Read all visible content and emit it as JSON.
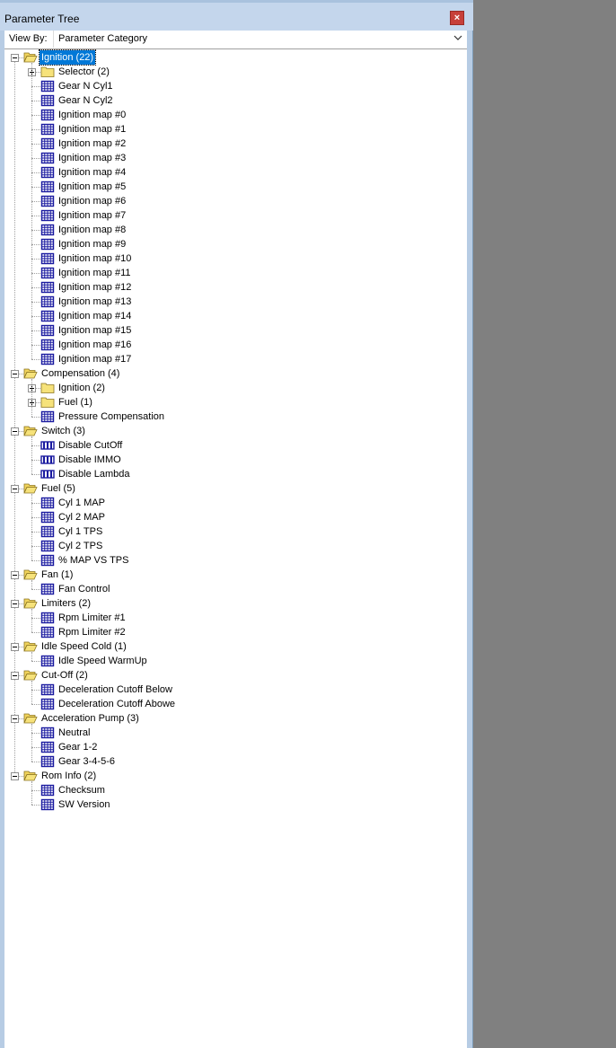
{
  "window": {
    "title": "Parameter Tree",
    "close_glyph": "×"
  },
  "view_by": {
    "label": "View By:",
    "value": "Parameter Category"
  },
  "colors": {
    "selection": "#0078d7",
    "folder": "#f6e27a",
    "table_icon": "#1a1aa0",
    "background": "#808080"
  },
  "tree": [
    {
      "label": "Ignition (22)",
      "type": "folder-open",
      "expanded": true,
      "selected": true,
      "children": [
        {
          "label": "Selector (2)",
          "type": "folder",
          "expanded": false
        },
        {
          "label": "Gear N Cyl1",
          "type": "table"
        },
        {
          "label": "Gear N Cyl2",
          "type": "table"
        },
        {
          "label": "Ignition map #0",
          "type": "table"
        },
        {
          "label": "Ignition map #1",
          "type": "table"
        },
        {
          "label": "Ignition map #2",
          "type": "table"
        },
        {
          "label": "Ignition map #3",
          "type": "table"
        },
        {
          "label": "Ignition map #4",
          "type": "table"
        },
        {
          "label": "Ignition map #5",
          "type": "table"
        },
        {
          "label": "Ignition map #6",
          "type": "table"
        },
        {
          "label": "Ignition map #7",
          "type": "table"
        },
        {
          "label": "Ignition map #8",
          "type": "table"
        },
        {
          "label": "Ignition map #9",
          "type": "table"
        },
        {
          "label": "Ignition map #10",
          "type": "table"
        },
        {
          "label": "Ignition map #11",
          "type": "table"
        },
        {
          "label": "Ignition map #12",
          "type": "table"
        },
        {
          "label": "Ignition map #13",
          "type": "table"
        },
        {
          "label": "Ignition map #14",
          "type": "table"
        },
        {
          "label": "Ignition map #15",
          "type": "table"
        },
        {
          "label": "Ignition map #16",
          "type": "table"
        },
        {
          "label": "Ignition map #17",
          "type": "table"
        }
      ]
    },
    {
      "label": "Compensation (4)",
      "type": "folder-open",
      "expanded": true,
      "children": [
        {
          "label": "Ignition (2)",
          "type": "folder",
          "expanded": false
        },
        {
          "label": "Fuel (1)",
          "type": "folder",
          "expanded": false
        },
        {
          "label": "Pressure Compensation",
          "type": "table"
        }
      ]
    },
    {
      "label": "Switch (3)",
      "type": "folder-open",
      "expanded": true,
      "children": [
        {
          "label": "Disable CutOff",
          "type": "switch"
        },
        {
          "label": "Disable IMMO",
          "type": "switch"
        },
        {
          "label": "Disable Lambda",
          "type": "switch"
        }
      ]
    },
    {
      "label": "Fuel (5)",
      "type": "folder-open",
      "expanded": true,
      "children": [
        {
          "label": "Cyl 1 MAP",
          "type": "table"
        },
        {
          "label": "Cyl 2 MAP",
          "type": "table"
        },
        {
          "label": "Cyl 1 TPS",
          "type": "table"
        },
        {
          "label": "Cyl 2 TPS",
          "type": "table"
        },
        {
          "label": "% MAP VS TPS",
          "type": "table"
        }
      ]
    },
    {
      "label": "Fan (1)",
      "type": "folder-open",
      "expanded": true,
      "children": [
        {
          "label": "Fan Control",
          "type": "table"
        }
      ]
    },
    {
      "label": "Limiters (2)",
      "type": "folder-open",
      "expanded": true,
      "children": [
        {
          "label": "Rpm Limiter #1",
          "type": "table"
        },
        {
          "label": "Rpm Limiter #2",
          "type": "table"
        }
      ]
    },
    {
      "label": "Idle Speed Cold (1)",
      "type": "folder-open",
      "expanded": true,
      "children": [
        {
          "label": "Idle Speed WarmUp",
          "type": "table"
        }
      ]
    },
    {
      "label": "Cut-Off (2)",
      "type": "folder-open",
      "expanded": true,
      "children": [
        {
          "label": "Deceleration Cutoff Below",
          "type": "table"
        },
        {
          "label": "Deceleration Cutoff Abowe",
          "type": "table"
        }
      ]
    },
    {
      "label": "Acceleration Pump (3)",
      "type": "folder-open",
      "expanded": true,
      "children": [
        {
          "label": "Neutral",
          "type": "table"
        },
        {
          "label": "Gear 1-2",
          "type": "table"
        },
        {
          "label": "Gear 3-4-5-6",
          "type": "table"
        }
      ]
    },
    {
      "label": "Rom Info (2)",
      "type": "folder-open",
      "expanded": true,
      "children": [
        {
          "label": "Checksum",
          "type": "table"
        },
        {
          "label": "SW Version",
          "type": "table"
        }
      ]
    }
  ]
}
